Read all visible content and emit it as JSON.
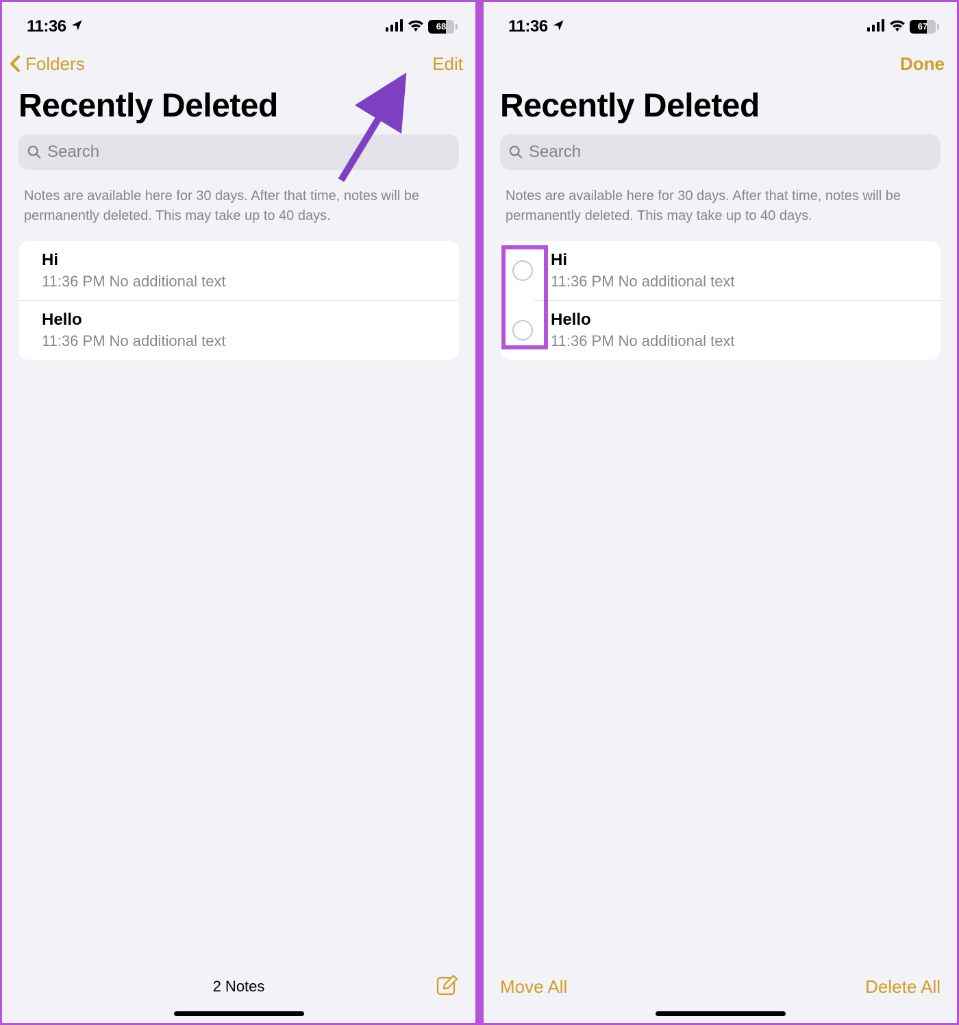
{
  "status": {
    "time": "11:36",
    "batteryLeft": "68",
    "batteryRight": "67",
    "batteryFillLeftPct": 68,
    "batteryFillRightPct": 67
  },
  "left": {
    "backLabel": "Folders",
    "editLabel": "Edit",
    "title": "Recently Deleted",
    "searchPlaceholder": "Search",
    "infoText": "Notes are available here for 30 days. After that time, notes will be permanently deleted. This may take up to 40 days.",
    "notes": [
      {
        "title": "Hi",
        "time": "11:36 PM",
        "subtitle": "No additional text"
      },
      {
        "title": "Hello",
        "time": "11:36 PM",
        "subtitle": "No additional text"
      }
    ],
    "footerCount": "2 Notes"
  },
  "right": {
    "doneLabel": "Done",
    "title": "Recently Deleted",
    "searchPlaceholder": "Search",
    "infoText": "Notes are available here for 30 days. After that time, notes will be permanently deleted. This may take up to 40 days.",
    "notes": [
      {
        "title": "Hi",
        "time": "11:36 PM",
        "subtitle": "No additional text"
      },
      {
        "title": "Hello",
        "time": "11:36 PM",
        "subtitle": "No additional text"
      }
    ],
    "moveAll": "Move All",
    "deleteAll": "Delete All"
  }
}
